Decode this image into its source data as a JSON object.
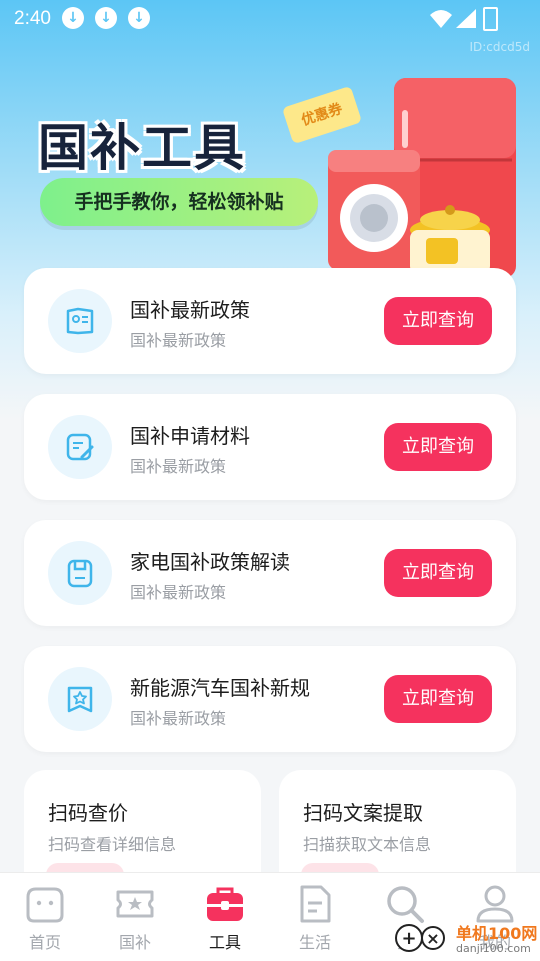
{
  "status": {
    "time": "2:40",
    "watermark": "ID:cdcd5d"
  },
  "banner": {
    "title": "国补工具",
    "subtitle": "手把手教你，轻松领补贴",
    "coupon": "优惠券"
  },
  "cards": [
    {
      "title": "国补最新政策",
      "subtitle": "国补最新政策",
      "button": "立即查询",
      "icon": "document-icon"
    },
    {
      "title": "国补申请材料",
      "subtitle": "国补最新政策",
      "button": "立即查询",
      "icon": "edit-document-icon"
    },
    {
      "title": "家电国补政策解读",
      "subtitle": "国补最新政策",
      "button": "立即查询",
      "icon": "clipboard-icon"
    },
    {
      "title": "新能源汽车国补新规",
      "subtitle": "国补最新政策",
      "button": "立即查询",
      "icon": "badge-icon"
    }
  ],
  "tools": [
    {
      "title": "扫码查价",
      "subtitle": "扫码查看详细信息"
    },
    {
      "title": "扫码文案提取",
      "subtitle": "扫描获取文本信息"
    }
  ],
  "nav": [
    {
      "label": "首页",
      "icon": "home-icon",
      "active": false
    },
    {
      "label": "国补",
      "icon": "ticket-icon",
      "active": false
    },
    {
      "label": "工具",
      "icon": "toolbox-icon",
      "active": true
    },
    {
      "label": "生活",
      "icon": "document-icon",
      "active": false
    },
    {
      "label": "查",
      "icon": "search-icon",
      "active": false
    },
    {
      "label": "我的",
      "icon": "user-icon",
      "active": false
    }
  ],
  "watermark": {
    "site": "单机100网",
    "url": "danji100.com"
  },
  "colors": {
    "accent": "#f5325e",
    "active_nav": "#f5325e",
    "sky": "#5cc6f5"
  }
}
